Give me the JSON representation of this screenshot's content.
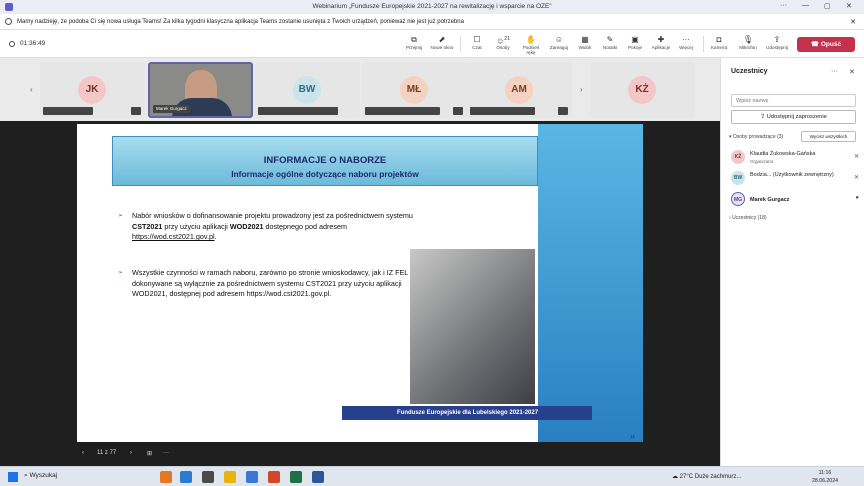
{
  "window": {
    "title": "Webinarium „Fundusze Europejskie 2021-2027 na rewitalizację i wsparcie na OZE”"
  },
  "notice": {
    "text": "Mamy nadzieję, że podoba Ci się nowa usługa Teams! Za kilka tygodni klasyczna aplikacja Teams zostanie usunięta z Twoich urządzeń, ponieważ nie jest już potrzebna"
  },
  "toolbar": {
    "timer": "01:36:49",
    "buttons": [
      {
        "label": "Przejmij",
        "icon": "share-control-icon"
      },
      {
        "label": "Nowe okno",
        "icon": "new-window-icon"
      },
      {
        "label": "Czat",
        "icon": "chat-icon"
      },
      {
        "label": "Osoby",
        "icon": "people-icon",
        "badge": "21"
      },
      {
        "label": "Podnieś rękę",
        "icon": "raise-hand-icon"
      },
      {
        "label": "Zareaguj",
        "icon": "react-icon"
      },
      {
        "label": "Widok",
        "icon": "view-icon"
      },
      {
        "label": "Notatki",
        "icon": "notes-icon"
      },
      {
        "label": "Pokoje",
        "icon": "rooms-icon"
      },
      {
        "label": "Aplikacje",
        "icon": "apps-icon"
      },
      {
        "label": "Więcej",
        "icon": "more-icon"
      },
      {
        "label": "Kamera",
        "icon": "camera-icon"
      },
      {
        "label": "Mikrofon",
        "icon": "mic-icon"
      },
      {
        "label": "Udostępnij",
        "icon": "share-icon"
      }
    ],
    "leave": "Opuść"
  },
  "tiles": [
    {
      "initials": "JK",
      "color": "#f3c7c7"
    },
    {
      "initials": "",
      "name": "Marek Gurgacz",
      "video": true
    },
    {
      "initials": "BW",
      "color": "#cbe3ea"
    },
    {
      "initials": "MŁ",
      "color": "#f3d2c1"
    },
    {
      "initials": "AM",
      "color": "#f3d2c1"
    },
    {
      "initials": "KŻ",
      "color": "#f3c7c7"
    }
  ],
  "slide": {
    "heading1": "INFORMACJE O NABORZE",
    "heading2": "Informacje ogólne dotyczące naboru projektów",
    "bullet1_pre": "Nabór wniosków o dofinansowanie projektu prowadzony jest za pośrednictwem systemu ",
    "bullet1_b1": "CST2021",
    "bullet1_mid": " przy użyciu aplikacji ",
    "bullet1_b2": "WOD2021",
    "bullet1_post": " dostępnego pod adresem",
    "bullet1_link": "https://wod.cst2021.gov.pl",
    "bullet2": "Wszystkie czynności w ramach naboru, zarówno po stronie wnioskodawcy, jak i IZ FEL dokonywane są wyłącznie za pośrednictwem systemu CST2021 przy użyciu aplikacji WOD2021, dostępnej pod adresem https://wod.cst2021.gov.pl.",
    "footer": "Fundusze Europejskie dla Lubelskiego 2021-2027",
    "page": "11",
    "nav_counter": "11 z 77"
  },
  "panel": {
    "title": "Uczestnicy",
    "search_placeholder": "Wpisz nazwę",
    "invite": "Udostępnij zaproszenie",
    "organizers_label": "Osoby prowadzące (3)",
    "mute_all": "Wycisz wszystkich",
    "people": [
      {
        "initials": "KŻ",
        "name": "Klaudia Żukowska-Gańska",
        "role": "Organizator",
        "color": "#f3c7c7"
      },
      {
        "initials": "BW",
        "name": "Bodzia... (Użytkownik zewnętrzny)",
        "role": "",
        "color": "#cbe3ea"
      },
      {
        "initials": "MG",
        "name": "Marek Gurgacz",
        "role": "",
        "color": "#e6e0f3"
      }
    ],
    "attendees_label": "Uczestnicy (18)"
  },
  "taskbar": {
    "search": "Wyszukaj",
    "weather": "27°C  Duże zachmurz...",
    "time": "11:16",
    "date": "28.06.2024"
  }
}
